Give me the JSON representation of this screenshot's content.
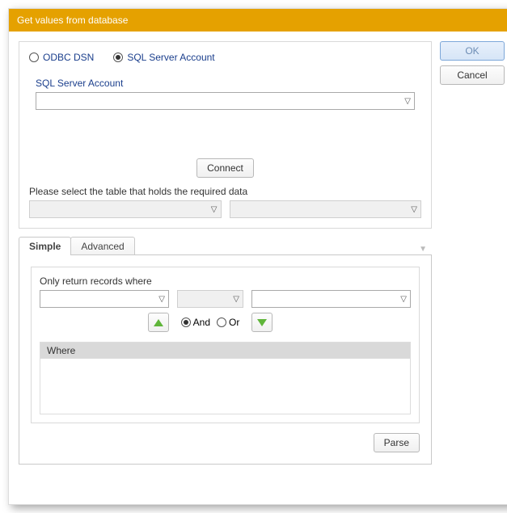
{
  "title": "Get values from database",
  "buttons": {
    "ok": "OK",
    "cancel": "Cancel",
    "connect": "Connect",
    "parse": "Parse"
  },
  "connection": {
    "odbc_label": "ODBC DSN",
    "sql_label": "SQL Server Account",
    "selected": "sql",
    "account_field_label": "SQL Server Account"
  },
  "table_prompt": "Please select the table that holds the required data",
  "tabs": {
    "simple": "Simple",
    "advanced": "Advanced",
    "active": "simple"
  },
  "filter": {
    "heading": "Only return records where",
    "logic": {
      "and": "And",
      "or": "Or",
      "selected": "and"
    },
    "where_header": "Where"
  }
}
